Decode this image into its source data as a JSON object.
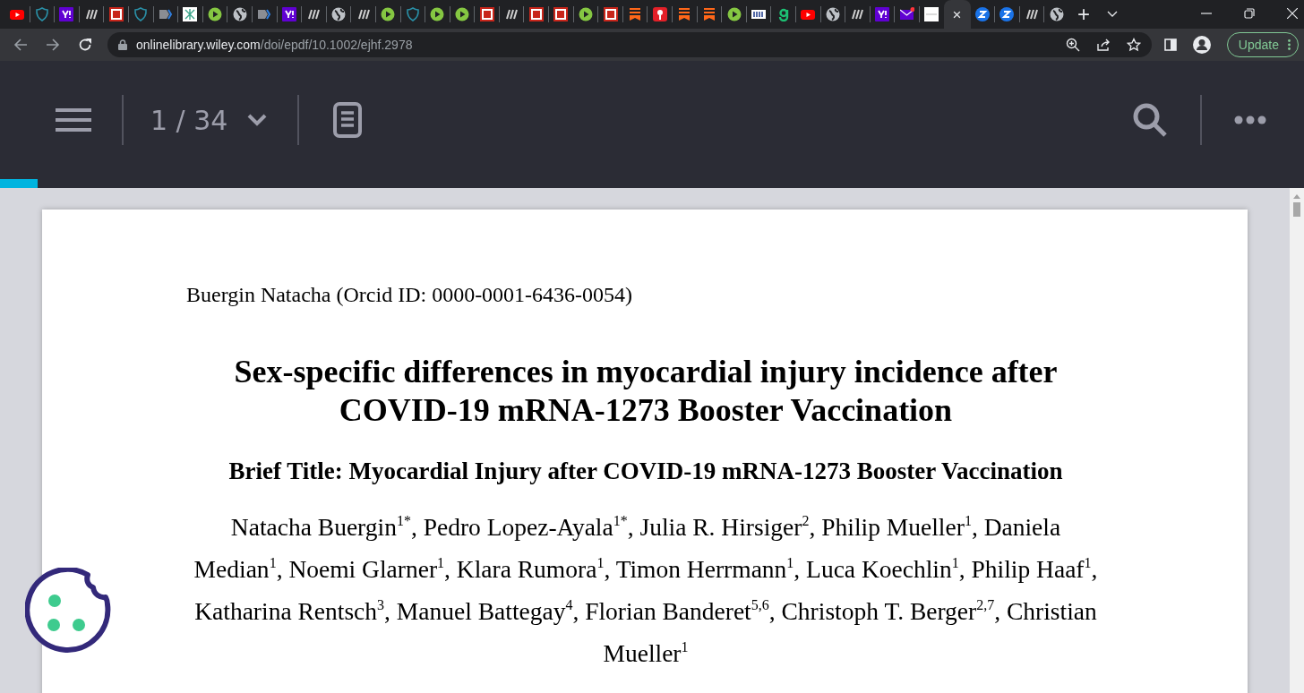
{
  "tabs": [
    {
      "kind": "video",
      "selected": false
    },
    {
      "kind": "shield",
      "selected": false
    },
    {
      "kind": "purple-square",
      "selected": false
    },
    {
      "kind": "slashes",
      "selected": false
    },
    {
      "kind": "red-square",
      "selected": false
    },
    {
      "kind": "shield",
      "selected": false
    },
    {
      "kind": "tag",
      "selected": false
    },
    {
      "kind": "grid",
      "selected": false
    },
    {
      "kind": "play-outline",
      "selected": false
    },
    {
      "kind": "globe",
      "selected": false
    },
    {
      "kind": "tag",
      "selected": false
    },
    {
      "kind": "purple-square",
      "selected": false
    },
    {
      "kind": "slashes",
      "selected": false
    },
    {
      "kind": "globe",
      "selected": false
    },
    {
      "kind": "slashes",
      "selected": false
    },
    {
      "kind": "play-outline",
      "selected": false
    },
    {
      "kind": "shield",
      "selected": false
    },
    {
      "kind": "play-outline",
      "selected": false
    },
    {
      "kind": "play-outline",
      "selected": false
    },
    {
      "kind": "red-square",
      "selected": false
    },
    {
      "kind": "slashes",
      "selected": false
    },
    {
      "kind": "red-square",
      "selected": false
    },
    {
      "kind": "red-square",
      "selected": false
    },
    {
      "kind": "play-outline",
      "selected": false
    },
    {
      "kind": "red-square",
      "selected": false
    },
    {
      "kind": "bookmark",
      "selected": false
    },
    {
      "kind": "pin",
      "selected": false
    },
    {
      "kind": "bookmark",
      "selected": false
    },
    {
      "kind": "bookmark",
      "selected": false
    },
    {
      "kind": "play-outline",
      "selected": false
    },
    {
      "kind": "banner",
      "selected": false
    },
    {
      "kind": "hook",
      "selected": false
    },
    {
      "kind": "video",
      "selected": false
    },
    {
      "kind": "globe",
      "selected": false
    },
    {
      "kind": "slashes",
      "selected": false
    },
    {
      "kind": "purple-square",
      "selected": false
    },
    {
      "kind": "envelope",
      "selected": false
    },
    {
      "kind": "page",
      "selected": false
    },
    {
      "kind": "none",
      "selected": true,
      "close": "×"
    },
    {
      "kind": "blue-circle",
      "selected": false
    },
    {
      "kind": "blue-circle",
      "selected": false
    },
    {
      "kind": "slashes",
      "selected": false
    },
    {
      "kind": "globe",
      "selected": false
    }
  ],
  "new_tab": "+",
  "address_bar": {
    "host": "onlinelibrary.wiley.com",
    "path": "/doi/epdf/10.1002/ejhf.2978",
    "update_button": "Update"
  },
  "viewer": {
    "page_indicator": "1 / 34",
    "progress": {
      "level": 0.029
    }
  },
  "document": {
    "orcid_line": "Buergin Natacha (Orcid ID: 0000-0001-6436-0054)",
    "title": "Sex-specific differences in myocardial injury incidence after COVID-19 mRNA-1273 Booster Vaccination",
    "brief_title": "Brief Title: Myocardial Injury after COVID-19 mRNA-1273 Booster Vaccination",
    "authors": "Natacha Buergin$^{1*}$, Pedro Lopez-Ayala$^{1*}$, Julia R. Hirsiger$^{2}$, Philip Mueller$^{1}$, Daniela Median$^{1}$, Noemi Glarner$^{1}$, Klara Rumora$^{1}$, Timon Herrmann$^{1}$, Luca Koechlin$^{1}$, Philip Haaf$^{1}$, Katharina Rentsch$^{3}$, Manuel Battegay$^{4}$, Florian Banderet$^{5,6}$, Christoph T. Berger$^{2,7}$, Christian Mueller$^{1}$"
  }
}
